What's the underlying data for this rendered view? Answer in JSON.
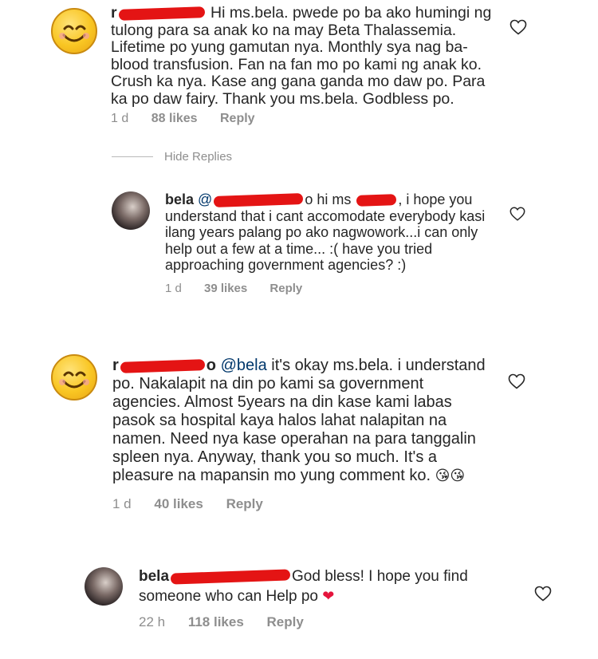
{
  "comments": [
    {
      "user_prefix": "r",
      "text": "Hi ms.bela. pwede po ba ako humingi ng tulong para sa anak ko na may Beta Thalassemia. Lifetime po yung gamutan nya. Monthly sya nag ba-blood transfusion. Fan na fan mo po kami ng anak ko. Crush ka nya. Kase ang gana ganda mo daw po. Para ka po daw fairy. Thank you ms.bela. Godbless po.",
      "time": "1 d",
      "likes": "88 likes",
      "reply": "Reply"
    },
    {
      "user": "bela",
      "mention": "@",
      "text_a": "o hi ms",
      "text_b": ", i hope you understand that i cant accomodate everybody kasi ilang years palang po ako nagwowork...i can only help out a few at a time... :( have you tried approaching government agencies? :)",
      "time": "1 d",
      "likes": "39 likes",
      "reply": "Reply"
    },
    {
      "user_prefix": "r",
      "mention_tail": "o",
      "mention": "@bela",
      "text": "it's okay ms.bela. i understand po. Nakalapit na din po kami sa government agencies. Almost 5years na din kase kami labas pasok sa hospital kaya halos lahat nalapitan na namen. Need nya kase operahan na para tanggalin spleen nya. Anyway,  thank you so much. It's a pleasure na mapansin mo yung comment ko.",
      "emoji": "😘😘",
      "time": "1 d",
      "likes": "40 likes",
      "reply": "Reply"
    },
    {
      "user": "bela",
      "text": "God bless! I hope you find someone who can Help po",
      "emoji": "❤",
      "time": "22 h",
      "likes": "118 likes",
      "reply": "Reply"
    }
  ],
  "hide_replies": "Hide Replies",
  "icons": {
    "avatar_1": "smiling-emoji-avatar",
    "avatar_2": "profile-photo-avatar",
    "like": "heart-outline-icon"
  },
  "colors": {
    "redaction": "#e41414",
    "meta": "#8e8e8e",
    "mention": "#00376b"
  }
}
